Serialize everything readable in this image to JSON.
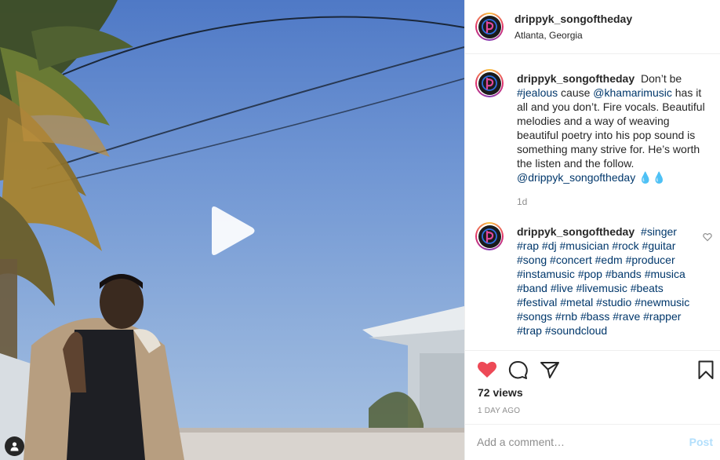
{
  "post": {
    "username": "drippyk_songoftheday",
    "location": "Atlanta, Georgia"
  },
  "caption": {
    "username": "drippyk_songoftheday",
    "parts": {
      "t1": "Don’t be",
      "tag1": "#jealous",
      "t2": "cause",
      "tag2": "@khamarimusic",
      "t3": "has it all and you don’t. Fire vocals. Beautiful melodies and a way of weaving beautiful poetry into his pop sound is something many strive for. He’s worth the listen and the follow.",
      "tag3": "@drippyk_songoftheday",
      "emoji": "💧💧"
    },
    "time": "1d"
  },
  "comment2": {
    "username": "drippyk_songoftheday",
    "hashtags": [
      "#singer",
      "#rap",
      "#dj",
      "#musician",
      "#rock",
      "#guitar",
      "#song",
      "#concert",
      "#edm",
      "#producer",
      "#instamusic",
      "#pop",
      "#bands",
      "#musica",
      "#band",
      "#live",
      "#livemusic",
      "#beats",
      "#festival",
      "#metal",
      "#studio",
      "#newmusic",
      "#songs",
      "#rnb",
      "#bass",
      "#rave",
      "#rapper",
      "#trap",
      "#soundcloud"
    ]
  },
  "stats": {
    "views": "72 views",
    "date": "1 DAY AGO"
  },
  "composer": {
    "placeholder": "Add a comment…",
    "post_label": "Post"
  },
  "icons": {
    "like": "heart-icon",
    "comment": "comment-icon",
    "share": "paper-plane-icon",
    "save": "bookmark-icon",
    "play": "play-icon",
    "tags": "user-tag-icon"
  },
  "colors": {
    "liked": "#ed4956",
    "link": "#00376b",
    "muted": "#8e8e8e",
    "post_disabled": "#b2dffc"
  }
}
